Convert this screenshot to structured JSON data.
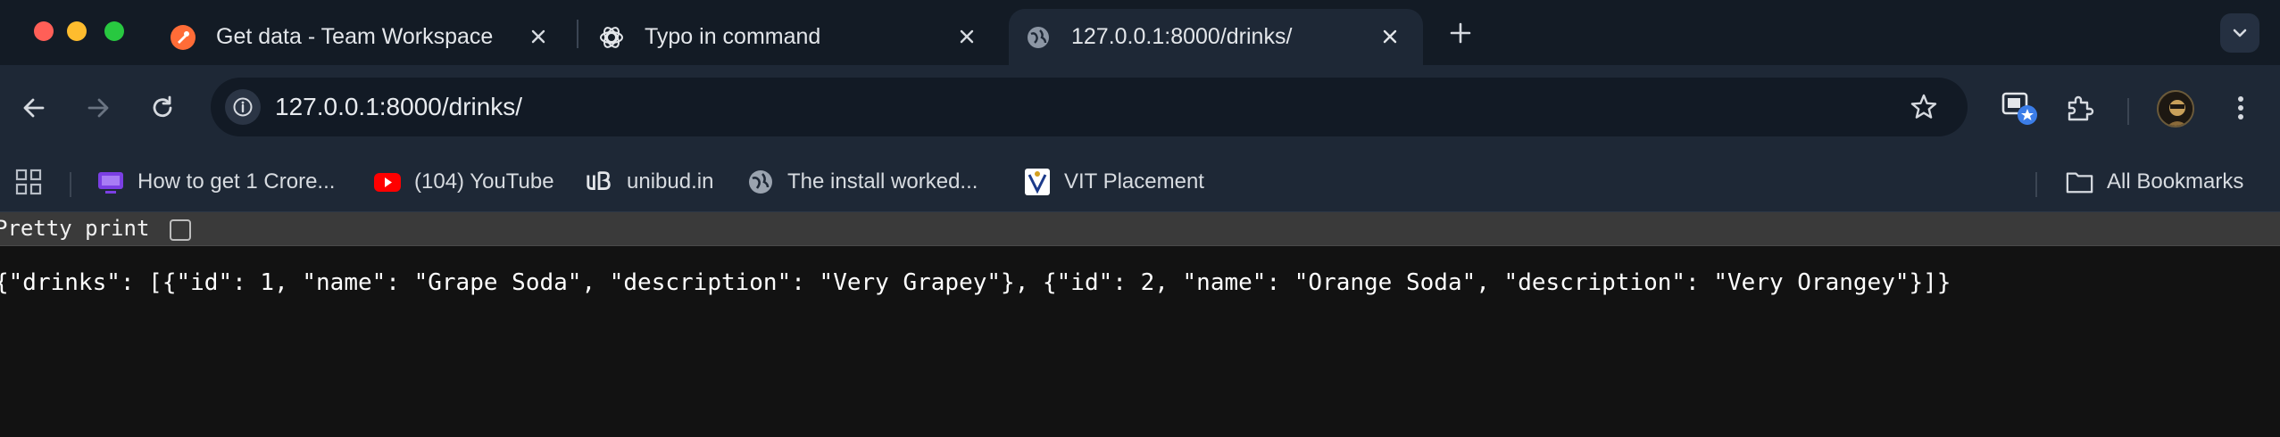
{
  "tabs": [
    {
      "title": "Get data - Team Workspace",
      "active": false
    },
    {
      "title": "Typo in command",
      "active": false
    },
    {
      "title": "127.0.0.1:8000/drinks/",
      "active": true
    }
  ],
  "omnibox": {
    "url": "127.0.0.1:8000/drinks/"
  },
  "bookmarks": [
    {
      "label": "How to get 1 Crore...",
      "icon": "tv-icon"
    },
    {
      "label": "(104) YouTube",
      "icon": "youtube-icon"
    },
    {
      "label": "unibud.in",
      "icon": "unibud-icon"
    },
    {
      "label": "The install worked...",
      "icon": "globe-icon"
    },
    {
      "label": "VIT Placement",
      "icon": "vit-logo-icon"
    }
  ],
  "all_bookmarks_label": "All Bookmarks",
  "page": {
    "pretty_print_label": "Pretty print",
    "json_text": "{\"drinks\": [{\"id\": 1, \"name\": \"Grape Soda\", \"description\": \"Very Grapey\"}, {\"id\": 2, \"name\": \"Orange Soda\", \"description\": \"Very Orangey\"}]}"
  },
  "colors": {
    "tabstrip_bg": "#131b25",
    "toolbar_bg": "#1e2836",
    "page_bg": "#121212",
    "postman_orange": "#ff6c37",
    "youtube_red": "#ff0000"
  }
}
